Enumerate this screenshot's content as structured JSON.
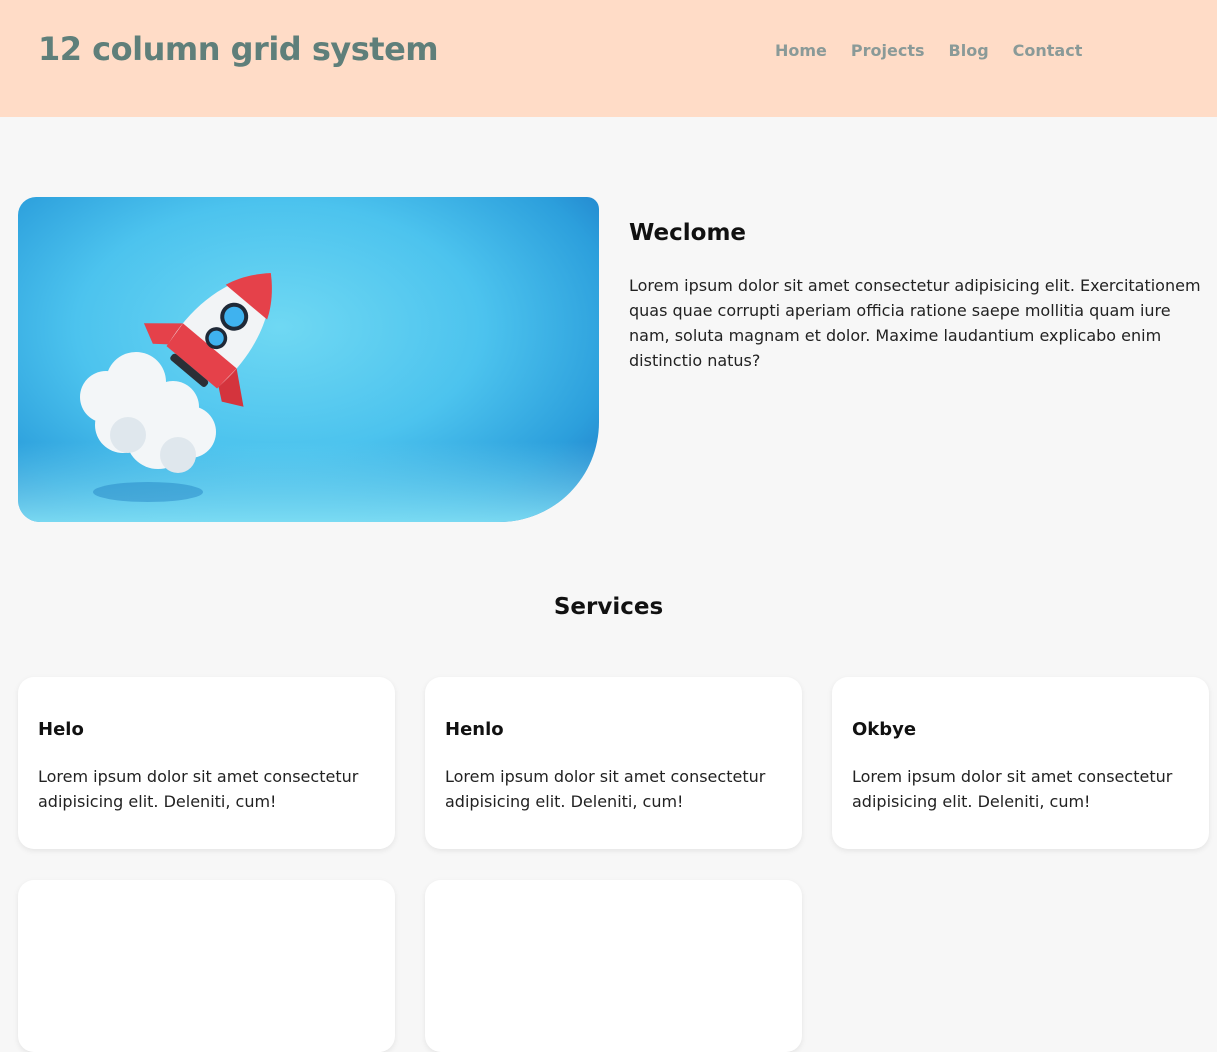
{
  "header": {
    "title": "12 column grid system",
    "nav": [
      "Home",
      "Projects",
      "Blog",
      "Contact"
    ]
  },
  "hero": {
    "image_icon": "rocket-launch-illustration",
    "title": "Weclome",
    "text": "Lorem ipsum dolor sit amet consectetur adipisicing elit. Exercitationem quas quae corrupti aperiam officia ratione saepe mollitia quam iure nam, soluta magnam et dolor. Maxime laudantium explicabo enim distinctio natus?"
  },
  "services": {
    "title": "Services",
    "cards": [
      {
        "title": "Helo",
        "text": "Lorem ipsum dolor sit amet consectetur adipisicing elit. Deleniti, cum!"
      },
      {
        "title": "Henlo",
        "text": "Lorem ipsum dolor sit amet consectetur adipisicing elit. Deleniti, cum!"
      },
      {
        "title": "Okbye",
        "text": "Lorem ipsum dolor sit amet consectetur adipisicing elit. Deleniti, cum!"
      }
    ]
  },
  "colors": {
    "header_bg": "#ffdcc7",
    "logo": "#5f7f7a",
    "nav": "#8a9a98",
    "page_bg": "#f7f7f7"
  }
}
